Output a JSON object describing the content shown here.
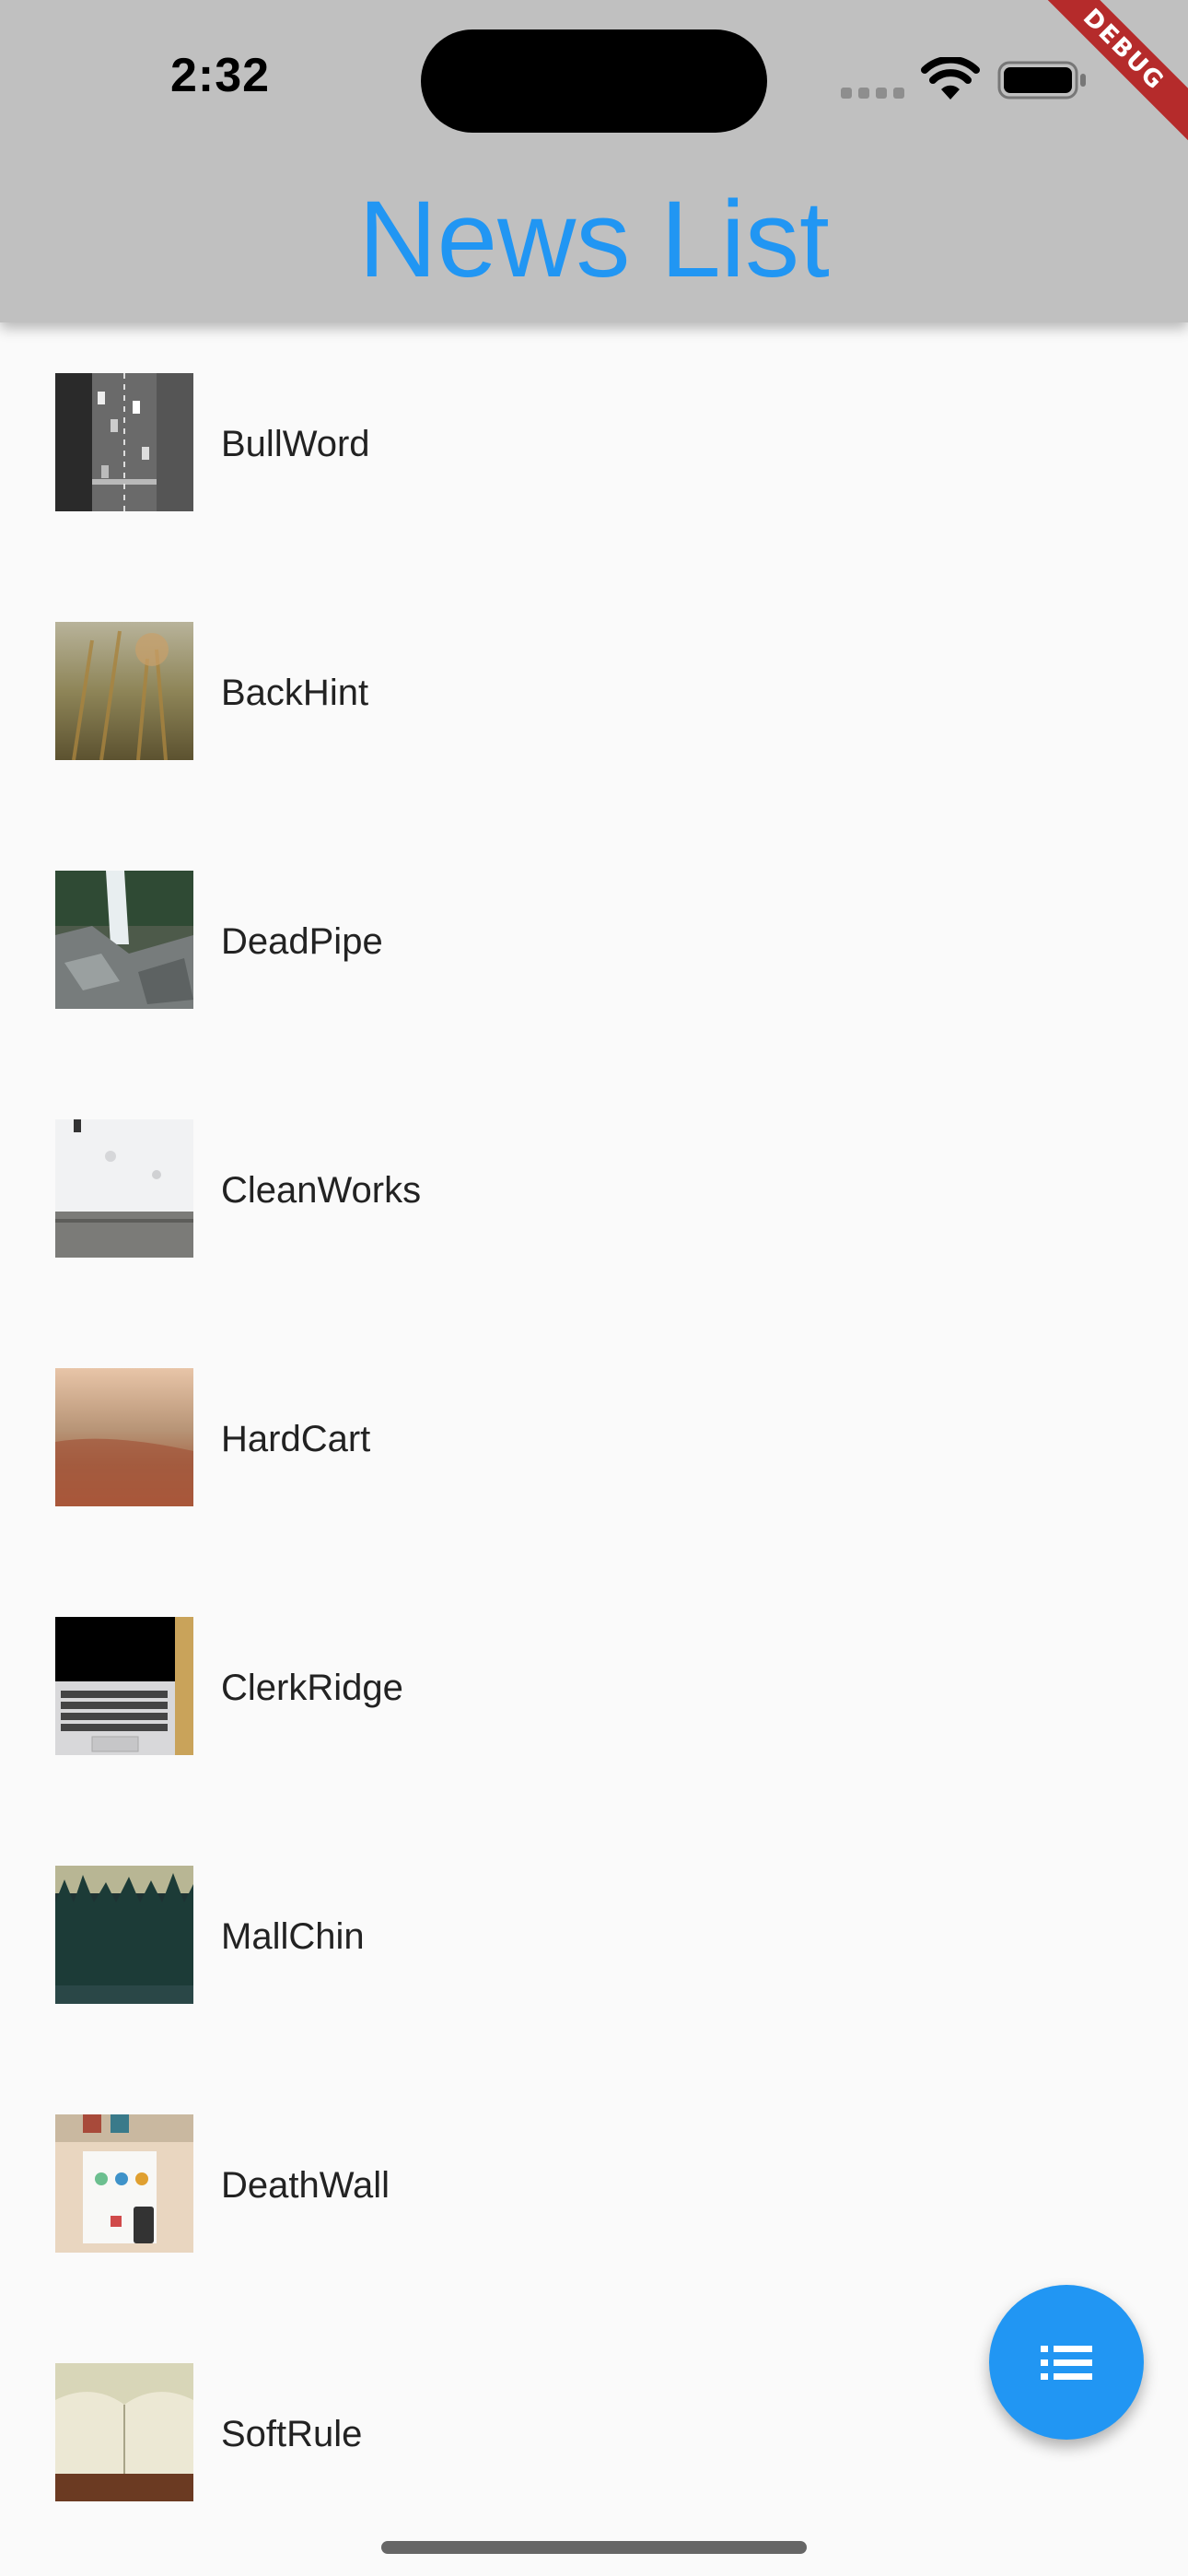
{
  "status_bar": {
    "time": "2:32"
  },
  "debug_banner": "DEBUG",
  "header": {
    "title": "News List"
  },
  "news_items": [
    {
      "title": "BullWord",
      "thumbnail": "aerial-highway-image"
    },
    {
      "title": "BackHint",
      "thumbnail": "wheat-field-image"
    },
    {
      "title": "DeadPipe",
      "thumbnail": "waterfall-rocks-image"
    },
    {
      "title": "CleanWorks",
      "thumbnail": "white-wall-image"
    },
    {
      "title": "HardCart",
      "thumbnail": "desert-haze-image"
    },
    {
      "title": "ClerkRidge",
      "thumbnail": "laptop-image"
    },
    {
      "title": "MallChin",
      "thumbnail": "forest-image"
    },
    {
      "title": "DeathWall",
      "thumbnail": "desk-items-image"
    },
    {
      "title": "SoftRule",
      "thumbnail": "open-book-image"
    }
  ],
  "fab": {
    "icon": "list-icon"
  },
  "colors": {
    "accent": "#2196f3",
    "app_bar": "#c0c0c0",
    "background": "#fafafa"
  }
}
